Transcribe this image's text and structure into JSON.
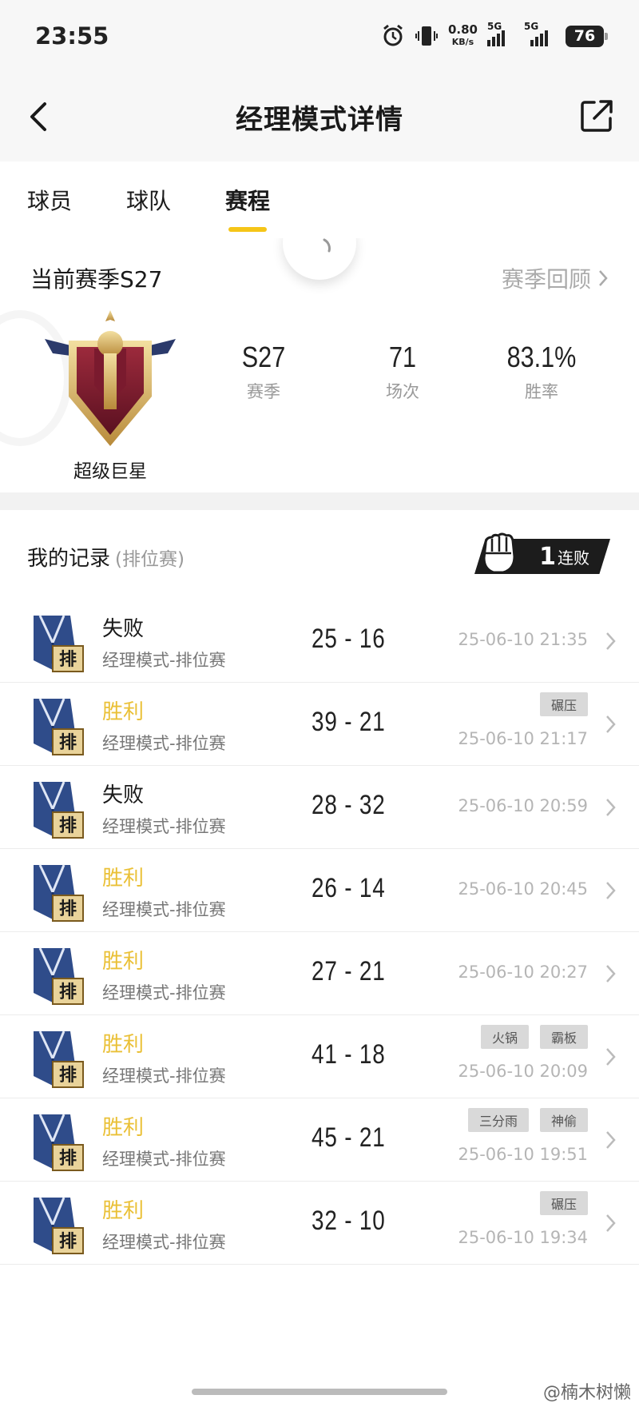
{
  "status_bar": {
    "time": "23:55",
    "net_speed": "0.80",
    "net_unit": "KB/s",
    "sig1": "5G",
    "sig2": "5G",
    "battery": "76"
  },
  "header": {
    "title": "经理模式详情"
  },
  "tabs": [
    {
      "label": "球员"
    },
    {
      "label": "球队"
    },
    {
      "label": "赛程"
    }
  ],
  "season": {
    "title": "当前赛季S27",
    "review": "赛季回顾",
    "badge_label": "超级巨星",
    "stats": [
      {
        "value": "S27",
        "label": "赛季"
      },
      {
        "value": "71",
        "label": "场次"
      },
      {
        "value": "83.1%",
        "label": "胜率"
      }
    ]
  },
  "records": {
    "title": "我的记录",
    "subtitle": "(排位赛)",
    "streak_num": "1",
    "streak_text": "连败",
    "rows": [
      {
        "result": "失败",
        "win": false,
        "mode": "经理模式-排位赛",
        "score": "25 - 16",
        "tags": [],
        "date": "25-06-10 21:35"
      },
      {
        "result": "胜利",
        "win": true,
        "mode": "经理模式-排位赛",
        "score": "39 - 21",
        "tags": [
          "碾压"
        ],
        "date": "25-06-10 21:17"
      },
      {
        "result": "失败",
        "win": false,
        "mode": "经理模式-排位赛",
        "score": "28 - 32",
        "tags": [],
        "date": "25-06-10 20:59"
      },
      {
        "result": "胜利",
        "win": true,
        "mode": "经理模式-排位赛",
        "score": "26 - 14",
        "tags": [],
        "date": "25-06-10 20:45"
      },
      {
        "result": "胜利",
        "win": true,
        "mode": "经理模式-排位赛",
        "score": "27 - 21",
        "tags": [],
        "date": "25-06-10 20:27"
      },
      {
        "result": "胜利",
        "win": true,
        "mode": "经理模式-排位赛",
        "score": "41 - 18",
        "tags": [
          "火锅",
          "霸板"
        ],
        "date": "25-06-10 20:09"
      },
      {
        "result": "胜利",
        "win": true,
        "mode": "经理模式-排位赛",
        "score": "45 - 21",
        "tags": [
          "三分雨",
          "神偷"
        ],
        "date": "25-06-10 19:51"
      },
      {
        "result": "胜利",
        "win": true,
        "mode": "经理模式-排位赛",
        "score": "32 - 10",
        "tags": [
          "碾压"
        ],
        "date": "25-06-10 19:34"
      }
    ]
  },
  "credit": "@楠木树懒",
  "colors": {
    "accent": "#f5c518",
    "win": "#eac036",
    "streak_bg": "#1c1c1c"
  }
}
